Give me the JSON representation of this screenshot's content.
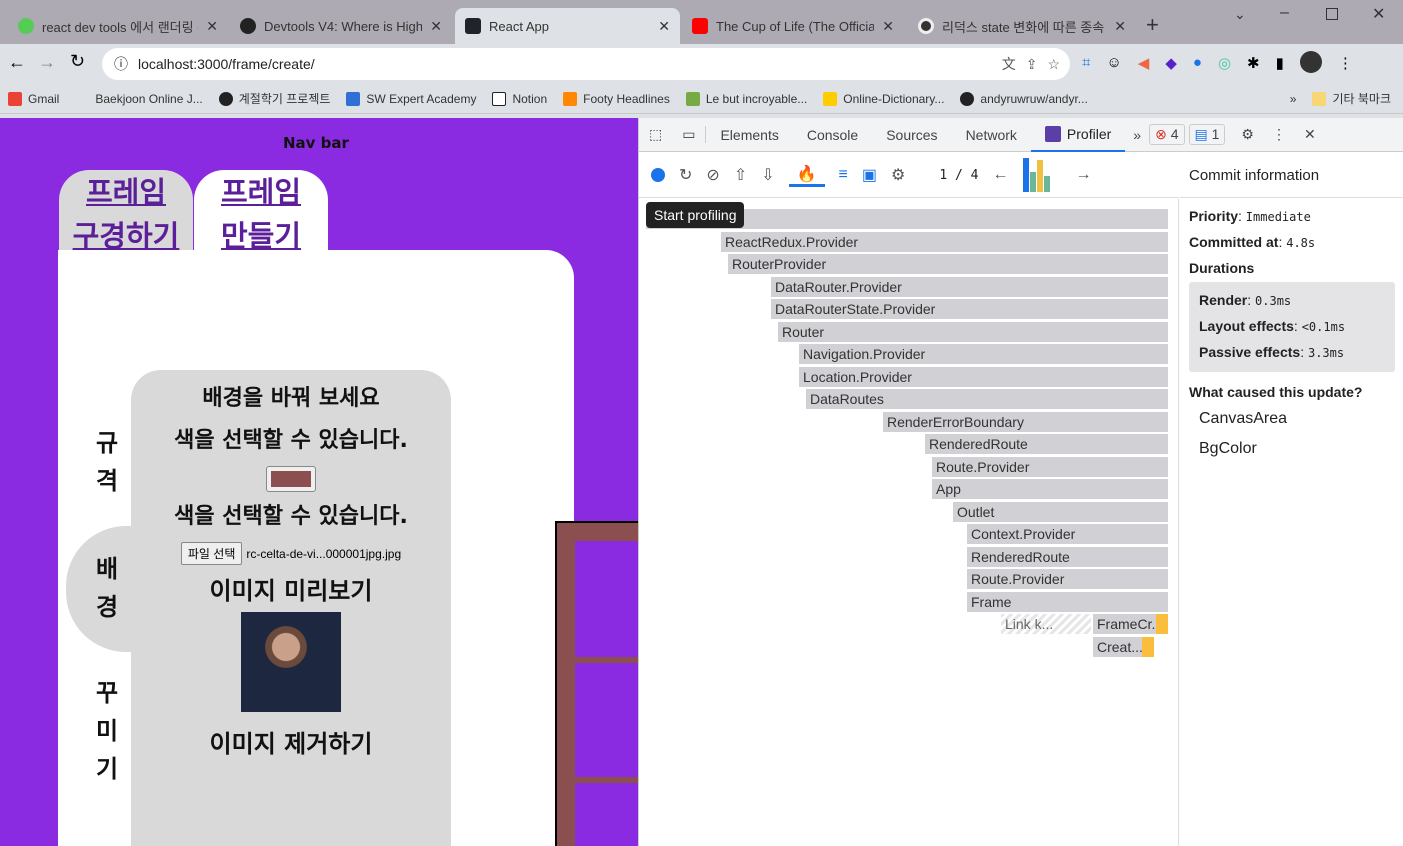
{
  "browser": {
    "tabs": [
      {
        "title": "react dev tools 에서 랜더링 부",
        "icon": "react-devtools-icon"
      },
      {
        "title": "Devtools V4: Where is Highlig",
        "icon": "github-icon"
      },
      {
        "title": "React App",
        "icon": "react-icon",
        "active": true
      },
      {
        "title": "The Cup of Life (The Official S",
        "icon": "youtube-icon"
      },
      {
        "title": "리덕스 state 변화에 따른 종속",
        "icon": "soccer-ball-icon"
      }
    ],
    "url": "localhost:3000/frame/create/",
    "bookmarks": [
      "Gmail",
      "Baekjoon Online J...",
      "계절학기 프로젝트",
      "SW Expert Academy",
      "Notion",
      "Footy Headlines",
      "Le but incroyable...",
      "Online-Dictionary...",
      "andyruwruw/andyr..."
    ],
    "bookmarks_more": "»",
    "other_bookmarks": "기타 북마크"
  },
  "app": {
    "nav_title": "Nav bar",
    "tab_browse": [
      "프레임",
      "구경하기"
    ],
    "tab_create": [
      "프레임",
      "만들기"
    ],
    "side_tabs": [
      [
        "규",
        "격"
      ],
      [
        "배",
        "경"
      ],
      [
        "꾸",
        "미",
        "기"
      ]
    ],
    "panel_title": "배경을 바꿔 보세요",
    "color_label_1": "색을 선택할 수 있습니다.",
    "color_value": "#8b4f4f",
    "color_label_2": "색을 선택할 수 있습니다.",
    "file_button": "파일 선택",
    "file_name": "rc-celta-de-vi...000001jpg.jpg",
    "preview_title": "이미지 미리보기",
    "remove_image": "이미지 제거하기",
    "accent": "#8a2be2"
  },
  "devtools": {
    "tabs": [
      "Elements",
      "Console",
      "Sources",
      "Network",
      "Profiler"
    ],
    "errors": "4",
    "messages": "1",
    "commit_index": "1",
    "commit_total": "4",
    "tooltip": "Start profiling",
    "flame": [
      "",
      "ReactRedux.Provider",
      "RouterProvider",
      "DataRouter.Provider",
      "DataRouterState.Provider",
      "Router",
      "Navigation.Provider",
      "Location.Provider",
      "DataRoutes",
      "RenderErrorBoundary",
      "RenderedRoute",
      "Route.Provider",
      "App",
      "Outlet",
      "Context.Provider",
      "RenderedRoute",
      "Route.Provider",
      "Frame",
      "Link k...",
      "FrameCr...",
      "Creat..."
    ],
    "commit": {
      "heading": "Commit information",
      "priority_label": "Priority",
      "priority": "Immediate",
      "committed_label": "Committed at",
      "committed": "4.8s",
      "durations": "Durations",
      "render_label": "Render",
      "render": "0.3ms",
      "layout_label": "Layout effects",
      "layout": "<0.1ms",
      "passive_label": "Passive effects",
      "passive": "3.3ms",
      "cause": "What caused this update?",
      "causes": [
        "CanvasArea",
        "BgColor"
      ]
    }
  }
}
